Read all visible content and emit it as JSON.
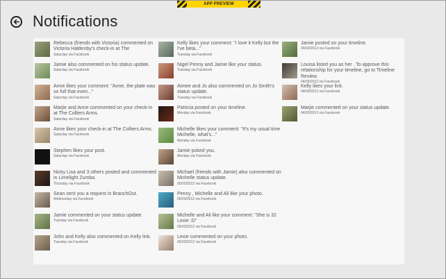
{
  "banner": {
    "label": "APP PREVIEW"
  },
  "header": {
    "title": "Notifications"
  },
  "columns": [
    [
      {
        "text": "Rebecca (friends with Victoria) commented on Victoria Haldenby's check-in at The",
        "meta": "Saturday via Facebook",
        "avatar": "a1"
      },
      {
        "text": "Jamie also commented on his status update.",
        "meta": "Saturday via Facebook",
        "avatar": "a2"
      },
      {
        "text": "Anne likes your comment: \"Anne, the plate was so full that even...\"",
        "meta": "Saturday via Facebook",
        "avatar": "a3"
      },
      {
        "text": "Marjie and Anne commented on your check-in at The Colliers Arms.",
        "meta": "Saturday via Facebook",
        "avatar": "a4"
      },
      {
        "text": "Anne likes your check-in at The Colliers Arms.",
        "meta": "Saturday via Facebook",
        "avatar": "a5"
      },
      {
        "text": "Stephen likes your post.",
        "meta": "Saturday via Facebook",
        "avatar": "a6"
      },
      {
        "text": "Nicky Lisa and 3 others posted and commented in Limelight Zumba.",
        "meta": "Thursday via Facebook",
        "avatar": "a7"
      },
      {
        "text": "Sean sent you a request in BranchOut.",
        "meta": "Wednesday via Facebook",
        "avatar": "a8"
      },
      {
        "text": "Jamie commented on your status update.",
        "meta": "Tuesday via Facebook",
        "avatar": "a9"
      },
      {
        "text": "John and Kelly also commented on Kelly link.",
        "meta": "Tuesday via Facebook",
        "avatar": "a10"
      }
    ],
    [
      {
        "text": "Kelly likes your comment: \"I love it Kelly but the I've beta...\"",
        "meta": "Tuesday via Facebook",
        "avatar": "a11"
      },
      {
        "text": "Nigel Penny and Jamie like your status.",
        "meta": "Tuesday via Facebook",
        "avatar": "a12"
      },
      {
        "text": "Aimee and Jo also commented on Jo Smith's status update.",
        "meta": "Tuesday via Facebook",
        "avatar": "a13"
      },
      {
        "text": "Patricia posted on your timeline.",
        "meta": "Monday via Facebook",
        "avatar": "a15"
      },
      {
        "text": "Michelle likes your comment: \"It's my usual time Michelle, what's...\"",
        "meta": "Monday via Facebook",
        "avatar": "a16"
      },
      {
        "text": "Jamie poked you.",
        "meta": "Monday via Facebook",
        "avatar": "a17"
      },
      {
        "text": "Michael (friends with Jamie) also commented on Michelle status update.",
        "meta": "05/03/2012 via Facebook",
        "avatar": "a18"
      },
      {
        "text": "Penny , Michelle and Ali like your photo.",
        "meta": "05/03/2012 via Facebook",
        "avatar": "a19"
      },
      {
        "text": "Michelle and Ali like your comment: \"She is 32 Lexie :D\"",
        "meta": "05/03/2012 via Facebook",
        "avatar": "a20"
      },
      {
        "text": "Lexie commented on your photo.",
        "meta": "05/03/2012 via Facebook",
        "avatar": "a21"
      }
    ],
    [
      {
        "text": "Jamie posted on your timeline.",
        "meta": "04/03/2012 via Facebook",
        "avatar": "a22"
      },
      {
        "text": "Louisa listed you as her . To approve this relationship for your timeline, go to Timeline Review.",
        "meta": "04/03/2012 via Facebook",
        "avatar": "a23"
      },
      {
        "text": "Kelly likes your link.",
        "meta": "04/03/2012 via Facebook",
        "avatar": "a24"
      },
      {
        "text": "Marjie commented on your status update.",
        "meta": "04/03/2012 via Facebook",
        "avatar": "a14"
      }
    ]
  ]
}
